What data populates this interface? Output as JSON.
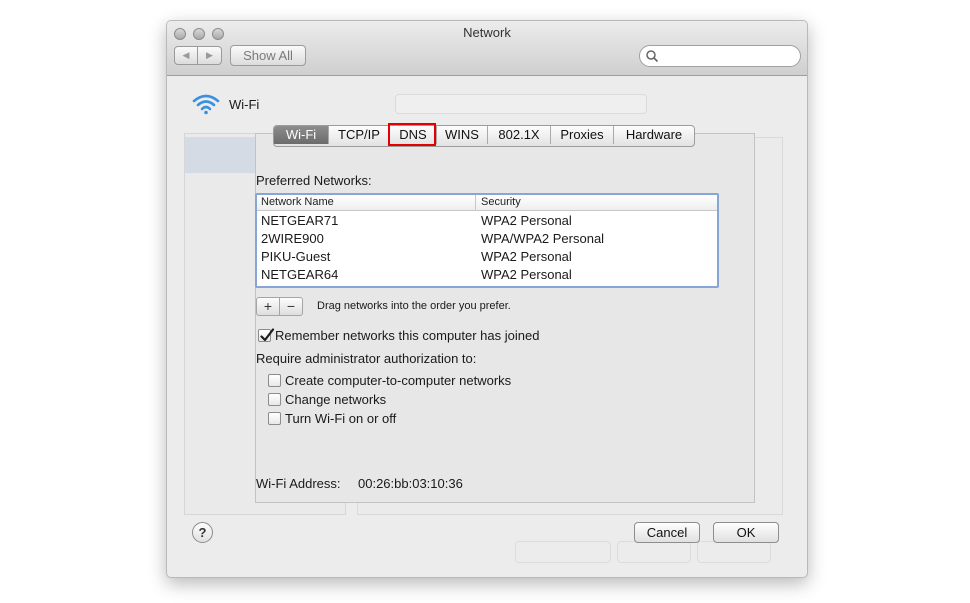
{
  "window": {
    "title": "Network"
  },
  "toolbar": {
    "back_glyph": "◀",
    "forward_glyph": "▶",
    "show_all_label": "Show All",
    "search_placeholder": ""
  },
  "service": {
    "name": "Wi-Fi"
  },
  "tabs": [
    {
      "label": "Wi-Fi",
      "active": true
    },
    {
      "label": "TCP/IP",
      "active": false
    },
    {
      "label": "DNS",
      "active": false,
      "highlighted": true
    },
    {
      "label": "WINS",
      "active": false
    },
    {
      "label": "802.1X",
      "active": false
    },
    {
      "label": "Proxies",
      "active": false
    },
    {
      "label": "Hardware",
      "active": false
    }
  ],
  "preferred": {
    "heading": "Preferred Networks:",
    "columns": [
      "Network Name",
      "Security"
    ],
    "rows": [
      [
        "NETGEAR71",
        "WPA2 Personal"
      ],
      [
        "2WIRE900",
        "WPA/WPA2 Personal"
      ],
      [
        "PIKU-Guest",
        "WPA2 Personal"
      ],
      [
        "NETGEAR64",
        "WPA2 Personal"
      ]
    ],
    "add_label": "+",
    "remove_label": "−",
    "hint": "Drag networks into the order you prefer."
  },
  "remember": {
    "label": "Remember networks this computer has joined",
    "checked": true
  },
  "require": {
    "heading": "Require administrator authorization to:",
    "options": [
      {
        "label": "Create computer-to-computer networks",
        "checked": false
      },
      {
        "label": "Change networks",
        "checked": false
      },
      {
        "label": "Turn Wi-Fi on or off",
        "checked": false
      }
    ]
  },
  "address": {
    "label": "Wi-Fi Address:",
    "value": "00:26:bb:03:10:36"
  },
  "buttons": {
    "help": "?",
    "cancel": "Cancel",
    "ok": "OK"
  },
  "colors": {
    "tab_active": "#7a7a7a",
    "table_border": "#86a7d6",
    "highlight_outline": "#e30000",
    "wifi_icon": "#3a8fe0"
  }
}
